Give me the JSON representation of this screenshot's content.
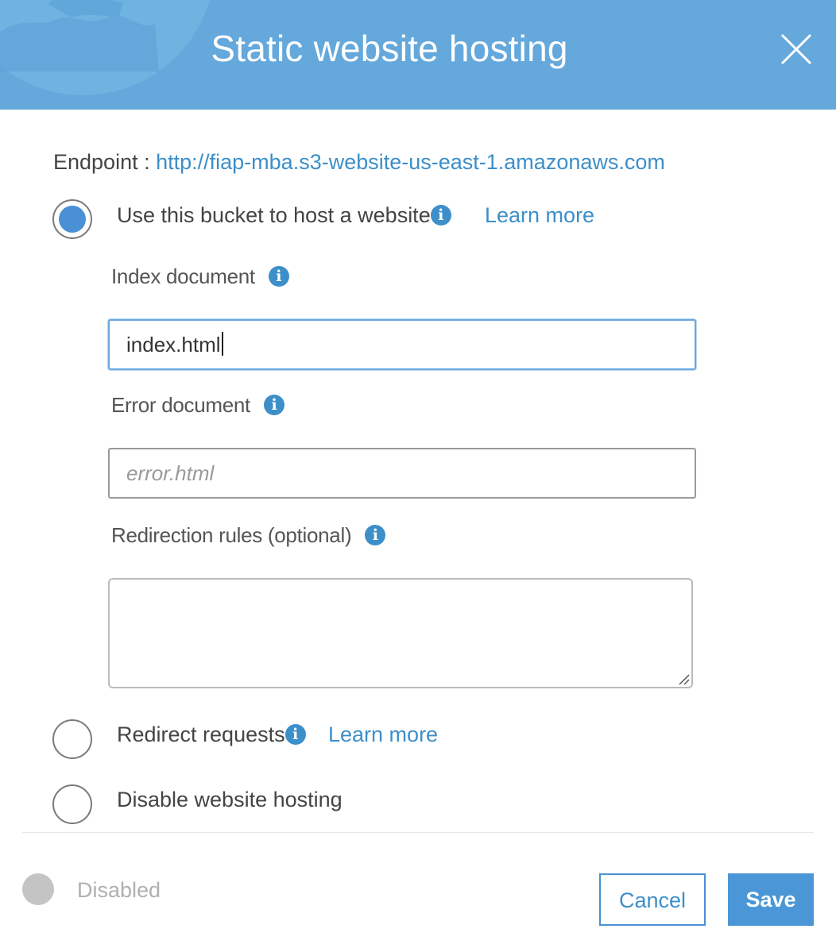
{
  "dialog": {
    "title": "Static website hosting",
    "close_icon": "close-icon"
  },
  "endpoint": {
    "label": "Endpoint :",
    "url": "http://fiap-mba.s3-website-us-east-1.amazonaws.com"
  },
  "options": [
    {
      "label": "Use this bucket to host a website",
      "selected": true,
      "learn_more": "Learn more",
      "info_icon": "info-icon"
    },
    {
      "label": "Redirect requests",
      "selected": false,
      "learn_more": "Learn more",
      "info_icon": "info-icon"
    },
    {
      "label": "Disable website hosting",
      "selected": false
    }
  ],
  "fields": {
    "index_document": {
      "label": "Index document",
      "value": "index.html"
    },
    "error_document": {
      "label": "Error document",
      "value": "",
      "placeholder": "error.html"
    },
    "redirection_rules": {
      "label": "Redirection rules (optional)",
      "value": ""
    }
  },
  "footer": {
    "status_label": "Disabled",
    "cancel_label": "Cancel",
    "save_label": "Save"
  },
  "colors": {
    "header": "#64a8dc",
    "accent": "#3c8fc9",
    "radio_fill": "#4a90d4",
    "disabled_gray": "#c4c4c4"
  }
}
